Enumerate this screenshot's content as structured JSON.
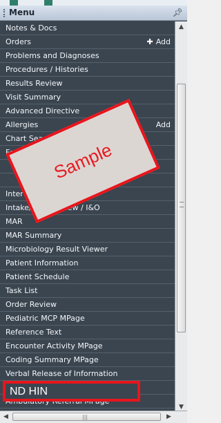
{
  "header": {
    "title": "Menu",
    "pin_icon": "pin-icon"
  },
  "items": [
    {
      "label": "Notes & Docs"
    },
    {
      "label": "Orders",
      "action": "Add"
    },
    {
      "label": "Problems and Diagnoses"
    },
    {
      "label": "Procedures / Histories"
    },
    {
      "label": "Results Review"
    },
    {
      "label": "Visit Summary"
    },
    {
      "label": "Advanced Directive"
    },
    {
      "label": "Allergies",
      "action": "Add"
    },
    {
      "label": "Chart Search"
    },
    {
      "label": "Form Browser"
    },
    {
      "label": ""
    },
    {
      "label": ""
    },
    {
      "label": "Intervention Schedule"
    },
    {
      "label": "Intake/Output View / I&O"
    },
    {
      "label": "MAR"
    },
    {
      "label": "MAR Summary"
    },
    {
      "label": "Microbiology Result Viewer"
    },
    {
      "label": "Patient Information"
    },
    {
      "label": "Patient Schedule"
    },
    {
      "label": "Task List"
    },
    {
      "label": "Order Review"
    },
    {
      "label": "Pediatric MCP MPage"
    },
    {
      "label": "Reference Text"
    },
    {
      "label": "Encounter Activity MPage"
    },
    {
      "label": "Coding Summary MPage"
    },
    {
      "label": "Verbal Release of Information"
    },
    {
      "label": ""
    },
    {
      "label": "Ambulatory Referral MPage"
    }
  ],
  "overlay": {
    "watermark": "Sample",
    "highlight": "ND HIN"
  },
  "colors": {
    "panel": "#3c4651",
    "accent": "#e8151c"
  }
}
